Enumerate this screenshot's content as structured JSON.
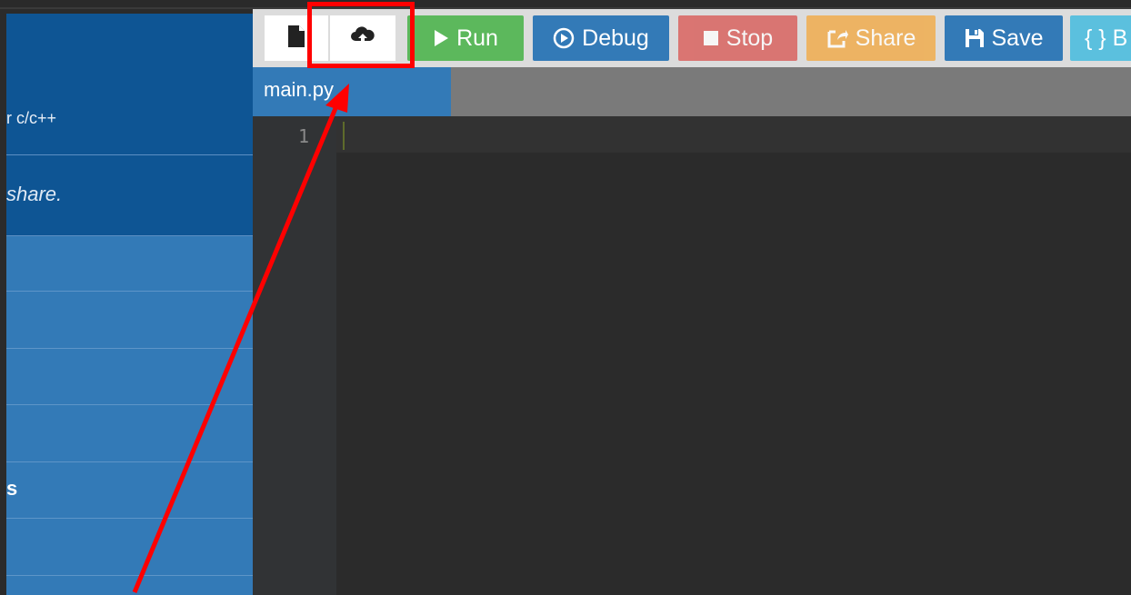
{
  "sidebar": {
    "subtitle": "r c/c++",
    "tagline": "share.",
    "items": [
      {
        "label": ""
      },
      {
        "label": ""
      },
      {
        "label": ""
      },
      {
        "label": ""
      },
      {
        "label": "s"
      },
      {
        "label": ""
      }
    ]
  },
  "toolbar": {
    "new_file_icon": "file-icon",
    "upload_icon": "cloud-upload-icon",
    "run": "Run",
    "debug": "Debug",
    "stop": "Stop",
    "share": "Share",
    "save": "Save",
    "beautify": "{ } B",
    "colors": {
      "run": "#5cb85c",
      "debug": "#337ab7",
      "stop": "#d9534f",
      "share": "#f0ad4e",
      "save": "#337ab7",
      "beautify": "#5bc0de"
    }
  },
  "editor": {
    "tab": "main.py",
    "line_numbers": [
      "1"
    ]
  },
  "annotation": {
    "highlight": "red box around upload button",
    "color": "#ff0000"
  }
}
